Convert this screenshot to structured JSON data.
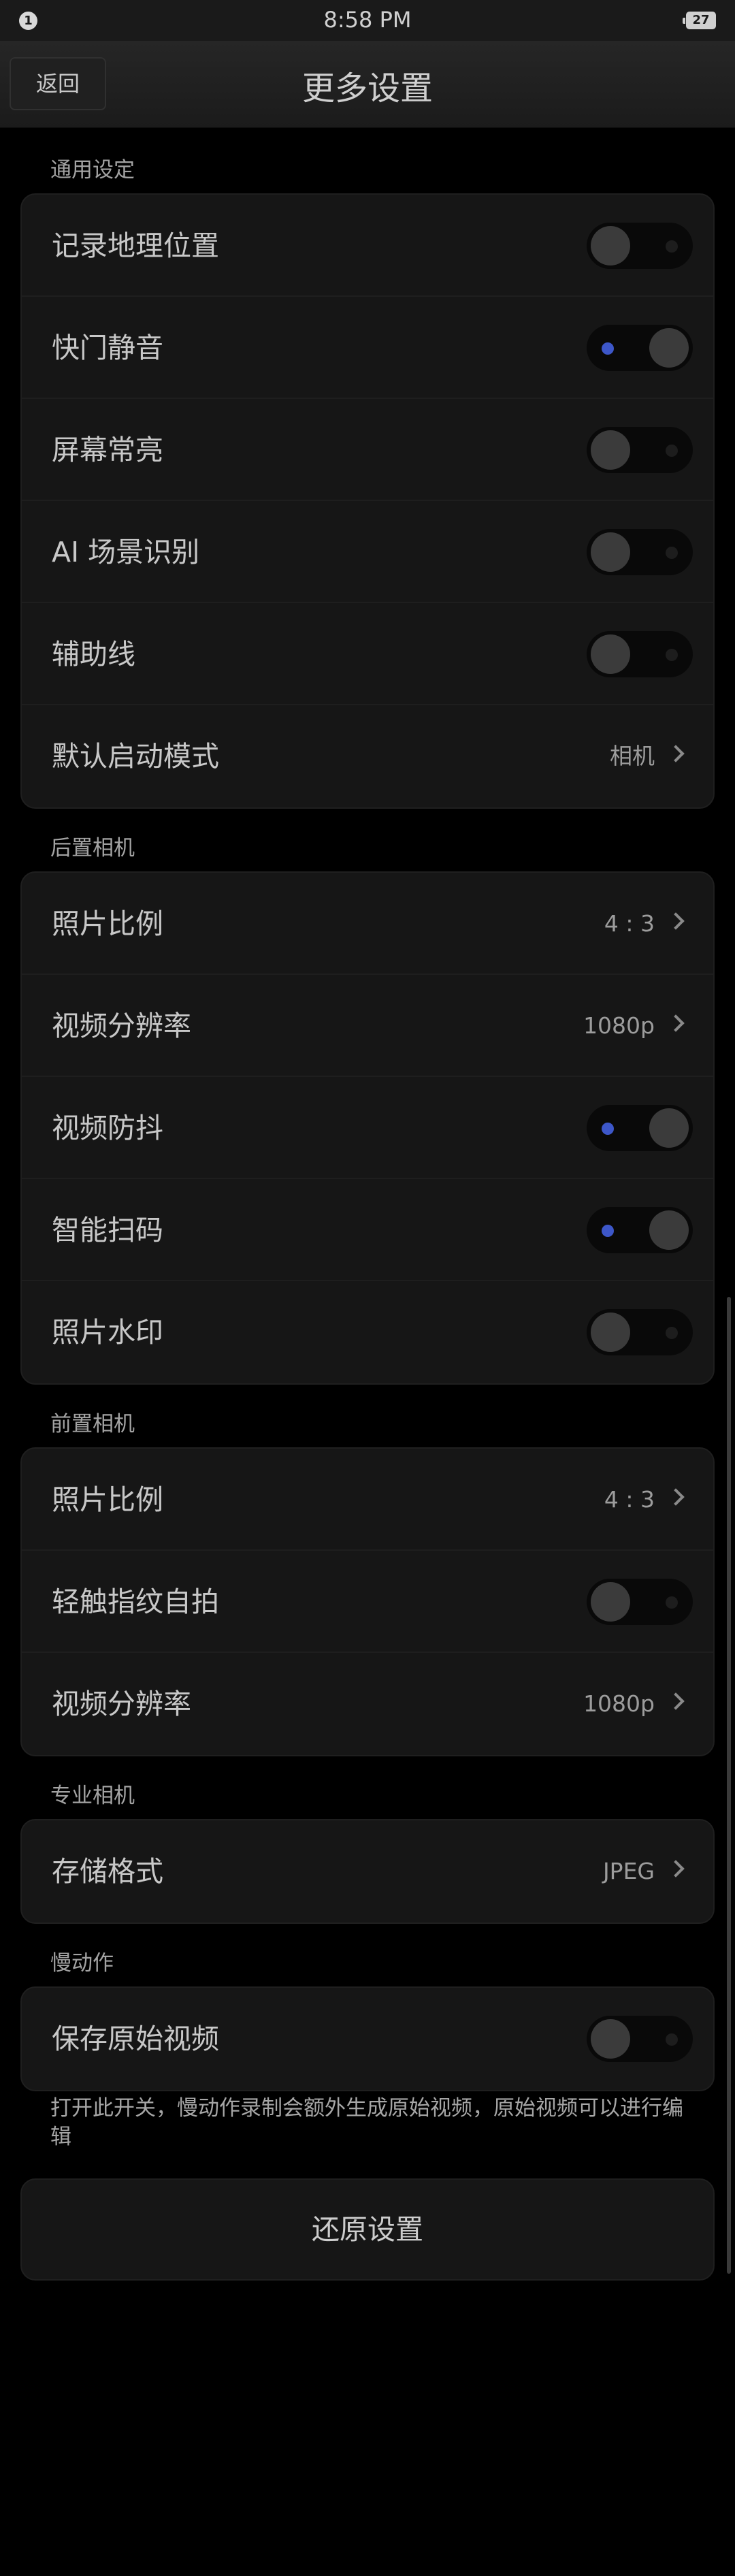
{
  "status": {
    "notification": "1",
    "time": "8:58 PM",
    "battery": "27"
  },
  "header": {
    "back_label": "返回",
    "title": "更多设置"
  },
  "sections": {
    "general": {
      "label": "通用设定",
      "rows": [
        {
          "label": "记录地理位置",
          "toggle": false
        },
        {
          "label": "快门静音",
          "toggle": true
        },
        {
          "label": "屏幕常亮",
          "toggle": false
        },
        {
          "label": "AI 场景识别",
          "toggle": false
        },
        {
          "label": "辅助线",
          "toggle": false
        },
        {
          "label": "默认启动模式",
          "value": "相机"
        }
      ]
    },
    "rear": {
      "label": "后置相机",
      "rows": [
        {
          "label": "照片比例",
          "value": "4 : 3"
        },
        {
          "label": "视频分辨率",
          "value": "1080p"
        },
        {
          "label": "视频防抖",
          "toggle": true
        },
        {
          "label": "智能扫码",
          "toggle": true
        },
        {
          "label": "照片水印",
          "toggle": false
        }
      ]
    },
    "front": {
      "label": "前置相机",
      "rows": [
        {
          "label": "照片比例",
          "value": "4 : 3"
        },
        {
          "label": "轻触指纹自拍",
          "toggle": false
        },
        {
          "label": "视频分辨率",
          "value": "1080p"
        }
      ]
    },
    "pro": {
      "label": "专业相机",
      "rows": [
        {
          "label": "存储格式",
          "value": "JPEG"
        }
      ]
    },
    "slowmo": {
      "label": "慢动作",
      "rows": [
        {
          "label": "保存原始视频",
          "toggle": false
        }
      ]
    }
  },
  "slowmo_note": "打开此开关，慢动作录制会额外生成原始视频，原始视频可以进行编辑",
  "reset_label": "还原设置",
  "colors": {
    "accent": "#3d57c9",
    "background": "#000000",
    "card": "#161616"
  }
}
